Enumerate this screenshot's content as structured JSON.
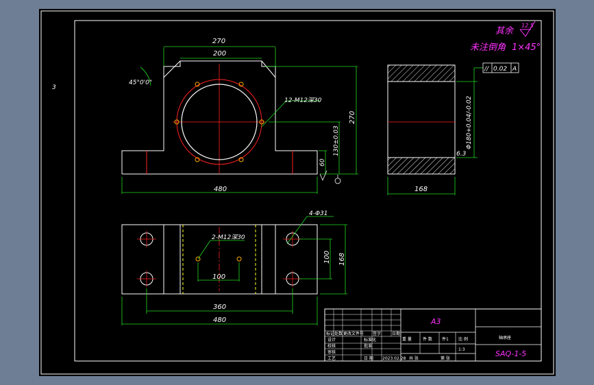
{
  "sheet": {
    "side_mark": "3"
  },
  "notes": {
    "roughness_prefix": "其余",
    "roughness_value": "12.5",
    "chamfer_note": "未注倒角",
    "chamfer_value": "1×45°"
  },
  "front_view": {
    "dim_width_top": "270",
    "dim_width_inner": "200",
    "dim_angle": "45°0'0\"",
    "dim_holes": "12-M12深30",
    "dim_height_total": "270",
    "dim_bore_height": "130±0.03",
    "dim_base_height": "60",
    "dim_base_width": "480"
  },
  "side_view": {
    "tol_symbol": "//",
    "tol_value": "0.02",
    "tol_datum": "A",
    "dim_bore": "Φ180+0.04/-0.02",
    "roughness": "6.3",
    "dim_width": "168"
  },
  "top_view": {
    "dim_bolt_holes": "4-Φ31",
    "dim_tapped": "2-M12深30",
    "dim_tapped_spacing": "100",
    "dim_hole_spacing_y": "100",
    "dim_depth": "168",
    "dim_hole_spacing_x": "360",
    "dim_length": "480"
  },
  "title_block": {
    "sheet_size": "A3",
    "part_name": "轴承座",
    "drawing_number": "SAQ-1-5",
    "scale_label": "比 例",
    "scale_value": "1:3",
    "weight_label": "重 量",
    "count_label": "件 数",
    "count_value": "件1",
    "designer_label": "设计",
    "checker_label": "校核",
    "reviewer_label": "审核",
    "process_label": "工艺",
    "standard_label": "标准化",
    "approve_label": "批准",
    "date_label": "日 期",
    "date_value": "2023.02.28",
    "sheet_total_label": "共 张",
    "sheet_label": "第 张",
    "head_labels": [
      "标记",
      "处数",
      "更改文件号",
      "签字",
      "日期"
    ]
  }
}
